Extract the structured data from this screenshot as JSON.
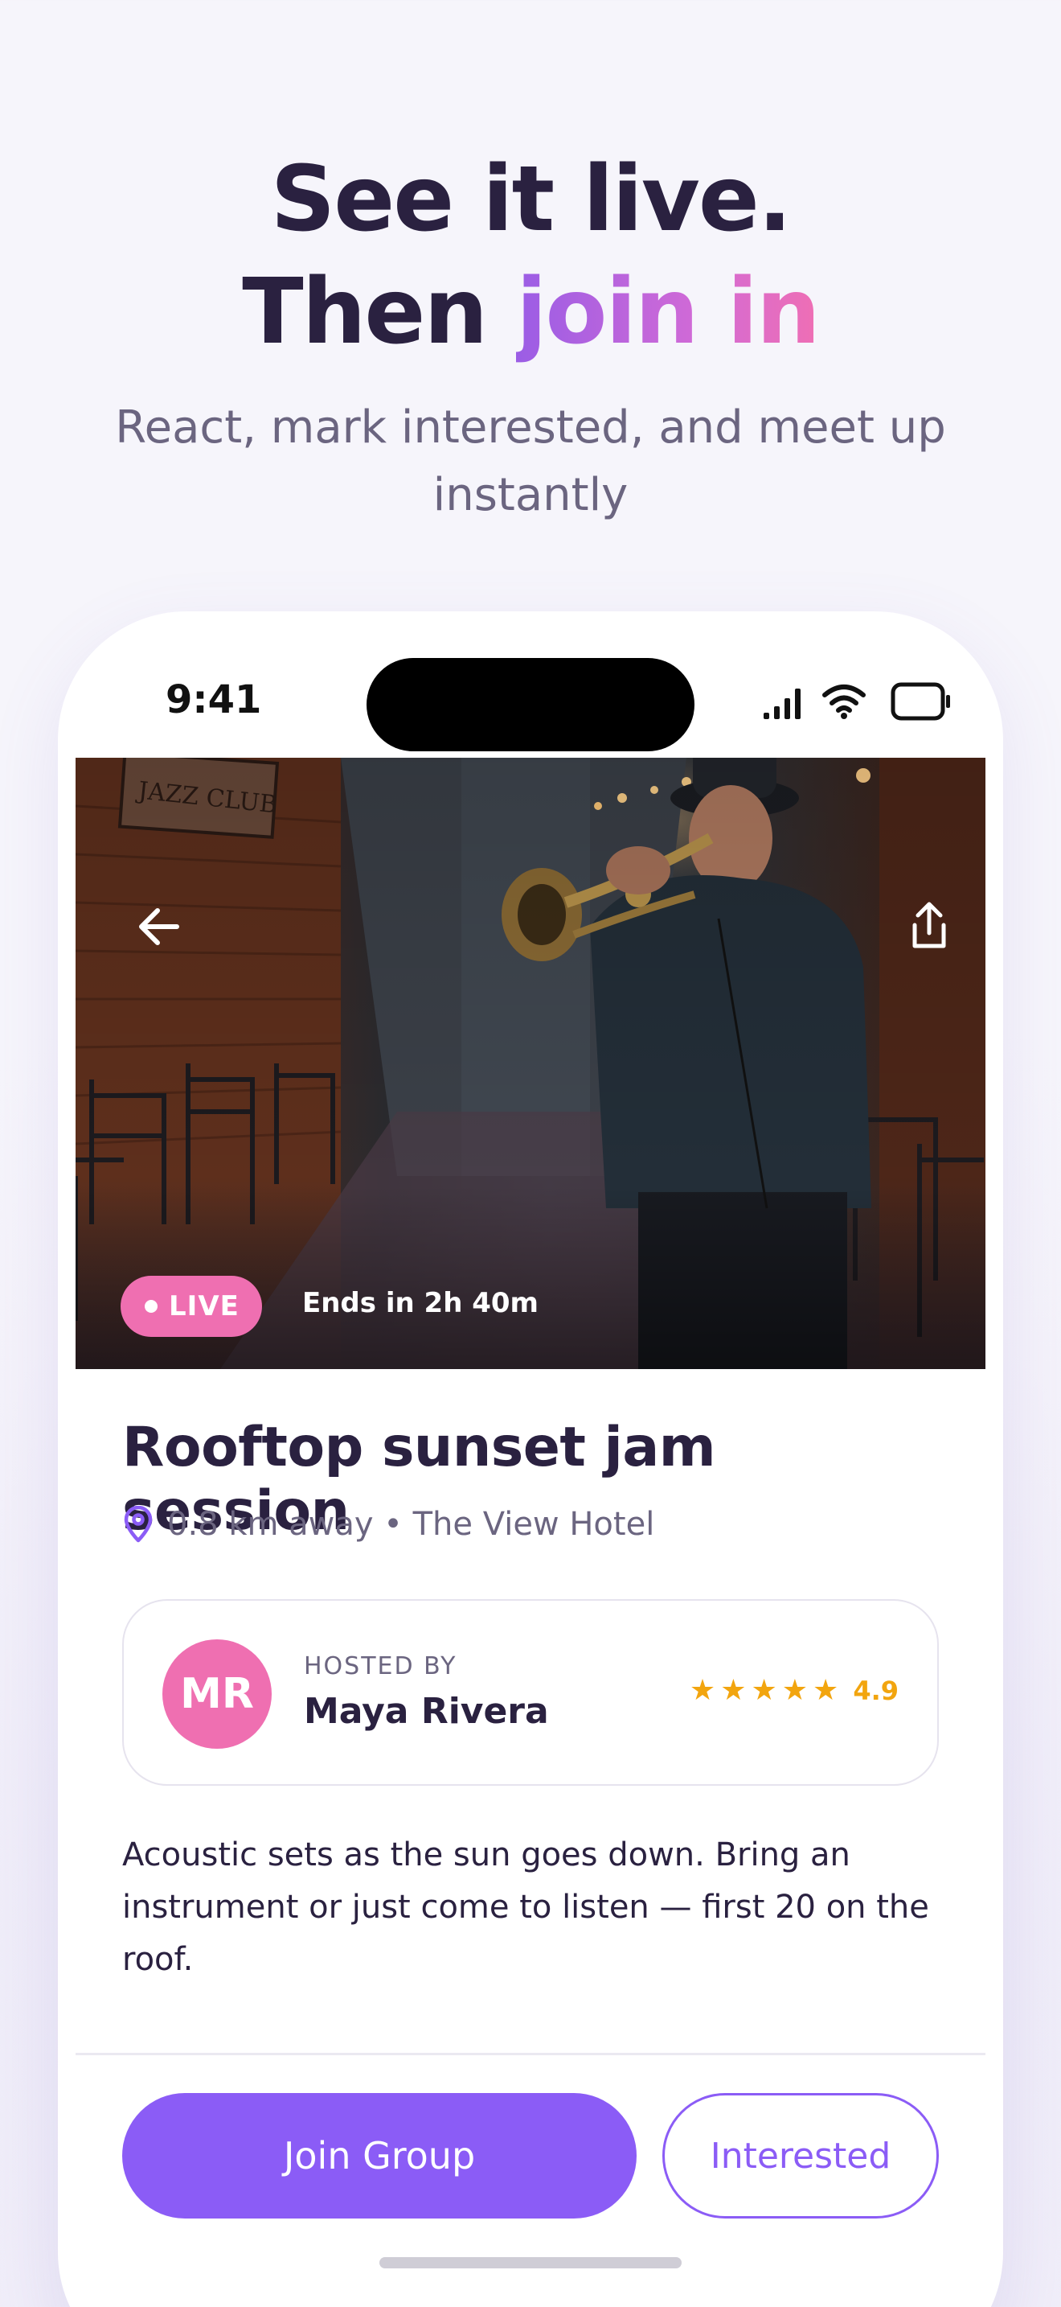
{
  "marketing": {
    "headline_line1": "See it live.",
    "headline_line2_prefix": "Then ",
    "headline_line2_accent": "join in",
    "subheadline": "React, mark interested, and meet up instantly"
  },
  "status_bar": {
    "time": "9:41",
    "icons": [
      "signal-icon",
      "wifi-icon",
      "battery-icon"
    ]
  },
  "hero": {
    "image_subject": "Trumpet player in a brick alley near a jazz club",
    "back_icon": "arrow-left-icon",
    "share_icon": "share-icon",
    "live_badge": "LIVE",
    "ends_text": "Ends in 2h 40m"
  },
  "event": {
    "title": "Rooftop sunset jam session",
    "location": "0.8 km away • The View Hotel",
    "location_icon": "map-pin-icon",
    "description": "Acoustic sets as the sun goes down. Bring an instrument or just come to listen — first 20 on the roof."
  },
  "host": {
    "label": "HOSTED BY",
    "initials": "MR",
    "name": "Maya Rivera",
    "rating": 4.9,
    "rating_text": "4.9",
    "stars": 5
  },
  "actions": {
    "join_label": "Join Group",
    "interested_label": "Interested"
  },
  "colors": {
    "accent_purple": "#8b5cf6",
    "accent_pink": "#ef6fb1",
    "star_gold": "#f2a50f",
    "text_dark": "#2a2140",
    "text_muted": "#6b6580"
  }
}
